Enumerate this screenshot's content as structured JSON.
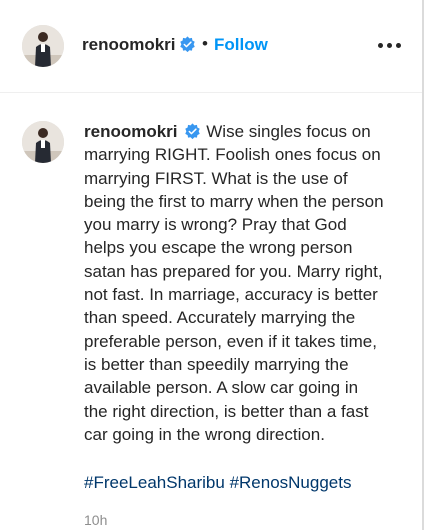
{
  "header": {
    "username": "renoomokri",
    "separator": "•",
    "follow_label": "Follow",
    "verified_icon": "verified-badge-icon",
    "more_icon": "more-options-icon"
  },
  "post": {
    "username": "renoomokri",
    "caption": "Wise singles focus on marrying RIGHT. Foolish ones focus on marrying FIRST. What is the use of being the first to marry when the person you marry is wrong? Pray that God helps you escape the wrong person satan has prepared for you. Marry right, not fast. In marriage, accuracy is better than speed. Accurately marrying the preferable person, even if it takes time, is better than speedily marrying the available person. A slow car going in the right direction, is better than a fast car going in the wrong direction.",
    "hashtags": [
      "#FreeLeahSharibu",
      "#RenosNuggets"
    ],
    "timestamp": "10h"
  },
  "colors": {
    "link_blue": "#0095f6",
    "hashtag_blue": "#00376b",
    "verified_blue": "#3897f0",
    "text": "#262626",
    "muted": "#8e8e8e"
  }
}
